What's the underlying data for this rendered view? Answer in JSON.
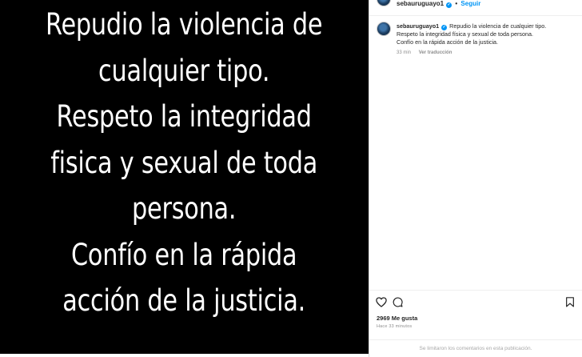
{
  "post_image": {
    "lines": [
      "Repudio la violencia de",
      "cualquier tipo.",
      "Respeto la integridad",
      "fisica y sexual de toda",
      "persona.",
      "Confío en la rápida",
      "acción de la justicia."
    ]
  },
  "header": {
    "username": "sebauruguayo1",
    "separator": "•",
    "follow_label": "Seguir"
  },
  "comment": {
    "username": "sebauruguayo1",
    "line1": "Repudio la violencia de cualquier tipo.",
    "line2": "Respeto la integridad física y sexual de toda persona.",
    "line3": "Confío en la rápida acción de la justicia.",
    "time": "33 min",
    "translate_label": "Ver traducción"
  },
  "actions": {
    "likes": "2969 Me gusta",
    "time_ago": "Hace 33 minutos"
  },
  "footer": {
    "limited_comments": "Se limitaron los comentarios en esta publicación."
  },
  "colors": {
    "accent": "#0095f6",
    "text": "#262626",
    "muted": "#8e8e8e",
    "image_bg": "#000000"
  },
  "icons": [
    "verified-icon",
    "heart-icon",
    "comment-icon",
    "bookmark-icon"
  ]
}
